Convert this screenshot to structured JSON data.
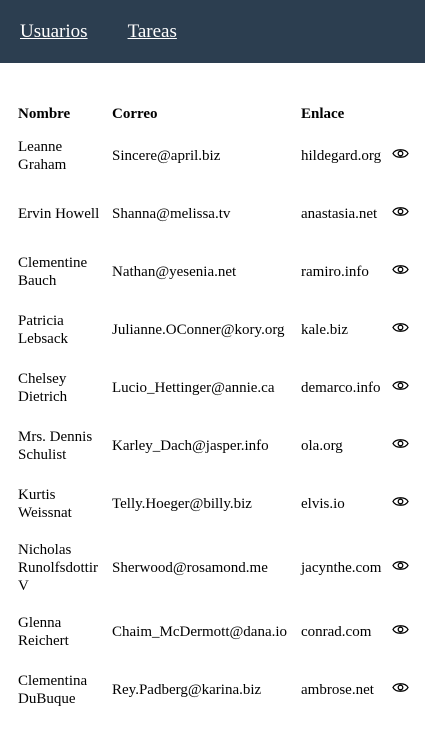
{
  "nav": {
    "users_label": "Usuarios",
    "tasks_label": "Tareas",
    "background": "#2c3e50"
  },
  "table": {
    "headers": {
      "name": "Nombre",
      "email": "Correo",
      "link": "Enlace"
    },
    "action_icon": "eye-icon",
    "rows": [
      {
        "name": "Leanne Graham",
        "email": "Sincere@april.biz",
        "link": "hildegard.org"
      },
      {
        "name": "Ervin Howell",
        "email": "Shanna@melissa.tv",
        "link": "anastasia.net"
      },
      {
        "name": "Clementine Bauch",
        "email": "Nathan@yesenia.net",
        "link": "ramiro.info"
      },
      {
        "name": "Patricia Lebsack",
        "email": "Julianne.OConner@kory.org",
        "link": "kale.biz"
      },
      {
        "name": "Chelsey Dietrich",
        "email": "Lucio_Hettinger@annie.ca",
        "link": "demarco.info"
      },
      {
        "name": "Mrs. Dennis Schulist",
        "email": "Karley_Dach@jasper.info",
        "link": "ola.org"
      },
      {
        "name": "Kurtis Weissnat",
        "email": "Telly.Hoeger@billy.biz",
        "link": "elvis.io"
      },
      {
        "name": "Nicholas Runolfsdottir V",
        "email": "Sherwood@rosamond.me",
        "link": "jacynthe.com"
      },
      {
        "name": "Glenna Reichert",
        "email": "Chaim_McDermott@dana.io",
        "link": "conrad.com"
      },
      {
        "name": "Clementina DuBuque",
        "email": "Rey.Padberg@karina.biz",
        "link": "ambrose.net"
      }
    ]
  }
}
